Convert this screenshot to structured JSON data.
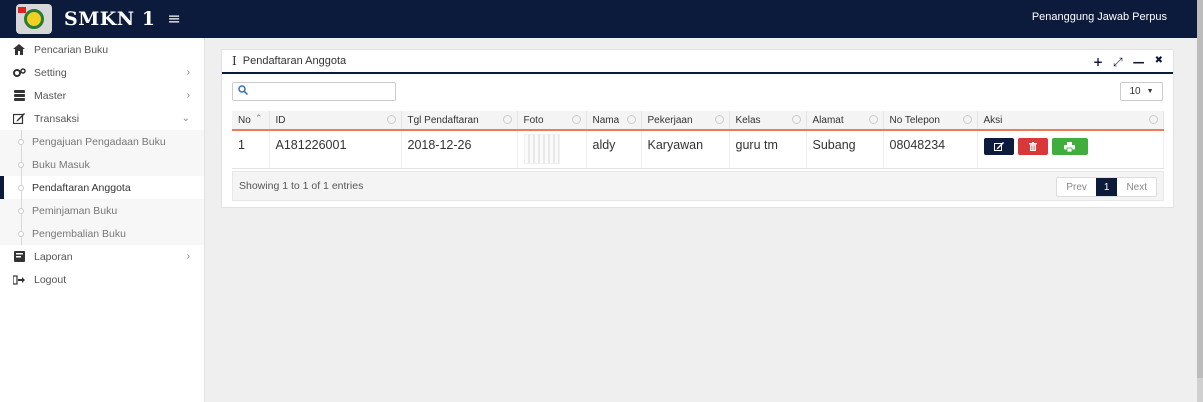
{
  "header": {
    "brand": "SMKN 1",
    "menu_icon": "≡",
    "user_role": "Penanggung Jawab Perpus"
  },
  "sidebar": {
    "items": [
      {
        "label": "Pencarian Buku",
        "icon": "home-icon"
      },
      {
        "label": "Setting",
        "icon": "gears-icon"
      },
      {
        "label": "Master",
        "icon": "database-icon"
      },
      {
        "label": "Transaksi",
        "icon": "edit-icon"
      }
    ],
    "submenu": [
      {
        "label": "Pengajuan Pengadaan Buku"
      },
      {
        "label": "Buku Masuk"
      },
      {
        "label": "Pendaftaran Anggota",
        "active": true
      },
      {
        "label": "Peminjaman Buku"
      },
      {
        "label": "Pengembalian Buku"
      }
    ],
    "bottom_items": [
      {
        "label": "Laporan",
        "icon": "book-icon"
      },
      {
        "label": "Logout",
        "icon": "sign-out-icon"
      }
    ]
  },
  "panel": {
    "title": "Pendaftaran Anggota",
    "tools": [
      "+",
      "⤢",
      "—",
      "✖"
    ]
  },
  "controls": {
    "search_placeholder": "",
    "page_size": "10"
  },
  "table": {
    "columns": [
      "No",
      "ID",
      "Tgl Pendaftaran",
      "Foto",
      "Nama",
      "Pekerjaan",
      "Kelas",
      "Alamat",
      "No Telepon",
      "Aksi"
    ],
    "rows": [
      {
        "no": "1",
        "id": "A181226001",
        "tgl": "2018-12-26",
        "nama": "aldy",
        "pekerjaan": "Karyawan",
        "kelas": "guru tm",
        "alamat": "Subang",
        "telepon": "08048234"
      }
    ]
  },
  "footer": {
    "entries": "Showing 1 to 1 of 1 entries",
    "prev": "Prev",
    "current_page": "1",
    "next": "Next"
  },
  "colors": {
    "navy": "#0c1a3c",
    "delete": "#d9383a",
    "print": "#3fae3c",
    "header_underline": "#ef7a5a"
  }
}
